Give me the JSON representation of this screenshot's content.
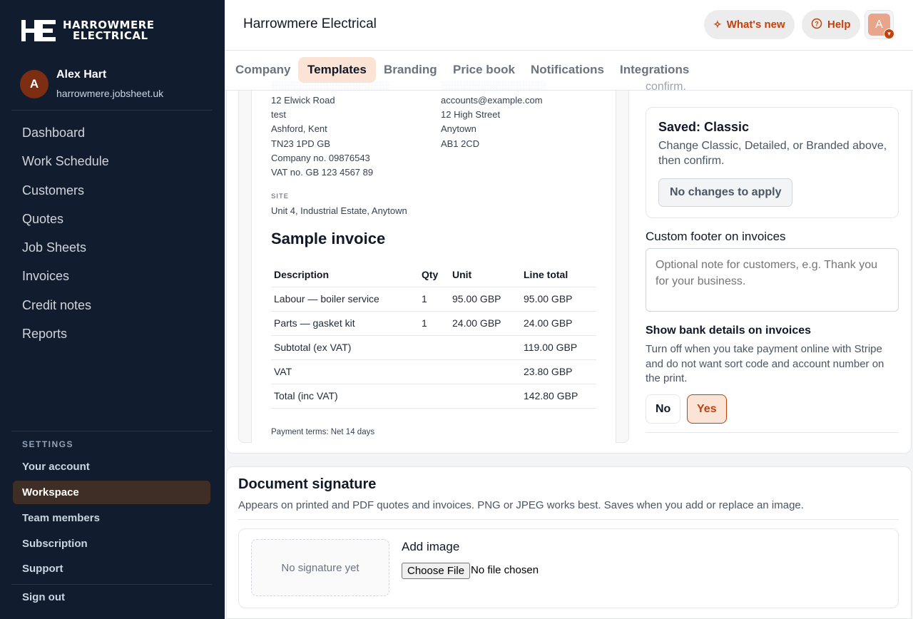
{
  "brand": {
    "name_line1": "HARROWMERE",
    "name_line2": "ELECTRICAL",
    "accent": "#c2410c"
  },
  "user": {
    "initial": "A",
    "name": "Alex Hart",
    "domain": "harrowmere.jobsheet.uk"
  },
  "nav": [
    "Dashboard",
    "Work Schedule",
    "Customers",
    "Quotes",
    "Job Sheets",
    "Invoices",
    "Credit notes",
    "Reports"
  ],
  "settings": {
    "label": "SETTINGS",
    "items": [
      "Your account",
      "Workspace",
      "Team members",
      "Subscription",
      "Support"
    ],
    "active": "Workspace"
  },
  "sign_out": "Sign out",
  "topbar": {
    "title": "Harrowmere Electrical",
    "whats_new": "What's new",
    "help": "Help",
    "avatar_initial": "A",
    "whats_new_icon": "sparkle-icon",
    "help_icon": "help-circle-icon"
  },
  "tabs": [
    "Company",
    "Templates",
    "Branding",
    "Price book",
    "Notifications",
    "Integrations"
  ],
  "active_tab": "Templates",
  "preview": {
    "from_address": [
      "12 Elwick Road",
      "test",
      "Ashford, Kent",
      "TN23 1PD GB",
      "Company no. 09876543",
      "VAT no. GB 123 4567 89"
    ],
    "to_address": [
      "accounts@example.com",
      "12 High Street",
      "Anytown",
      "AB1 2CD"
    ],
    "site_label": "SITE",
    "site_value": "Unit 4, Industrial Estate, Anytown",
    "title": "Sample invoice",
    "columns": [
      "Description",
      "Qty",
      "Unit",
      "Line total"
    ],
    "rows": [
      [
        "Labour — boiler service",
        "1",
        "95.00 GBP",
        "95.00 GBP"
      ],
      [
        "Parts — gasket kit",
        "1",
        "24.00 GBP",
        "24.00 GBP"
      ],
      [
        "Subtotal (ex VAT)",
        "",
        "",
        "119.00 GBP"
      ],
      [
        "VAT",
        "",
        "",
        "23.80 GBP"
      ],
      [
        "Total (inc VAT)",
        "",
        "",
        "142.80 GBP"
      ]
    ],
    "terms": "Payment terms: Net 14 days"
  },
  "template_panel": {
    "confirm_fragment": "confirm.",
    "saved_title": "Saved: Classic",
    "saved_desc": "Change Classic, Detailed, or Branded above, then confirm.",
    "apply_button": "No changes to apply",
    "footer_label": "Custom footer on invoices",
    "footer_placeholder": "Optional note for customers, e.g. Thank you for your business.",
    "footer_value": "",
    "bank_title": "Show bank details on invoices",
    "bank_desc": "Turn off when you take payment online with Stripe and do not want sort code and account number on the print.",
    "no_label": "No",
    "yes_label": "Yes",
    "bank_selected": "Yes"
  },
  "signature": {
    "title": "Document signature",
    "desc": "Appears on printed and PDF quotes and invoices. PNG or JPEG works best. Saves when you add or replace an image.",
    "placeholder": "No signature yet",
    "add_label": "Add image",
    "file_button": "Choose File",
    "file_status": "No file chosen"
  }
}
